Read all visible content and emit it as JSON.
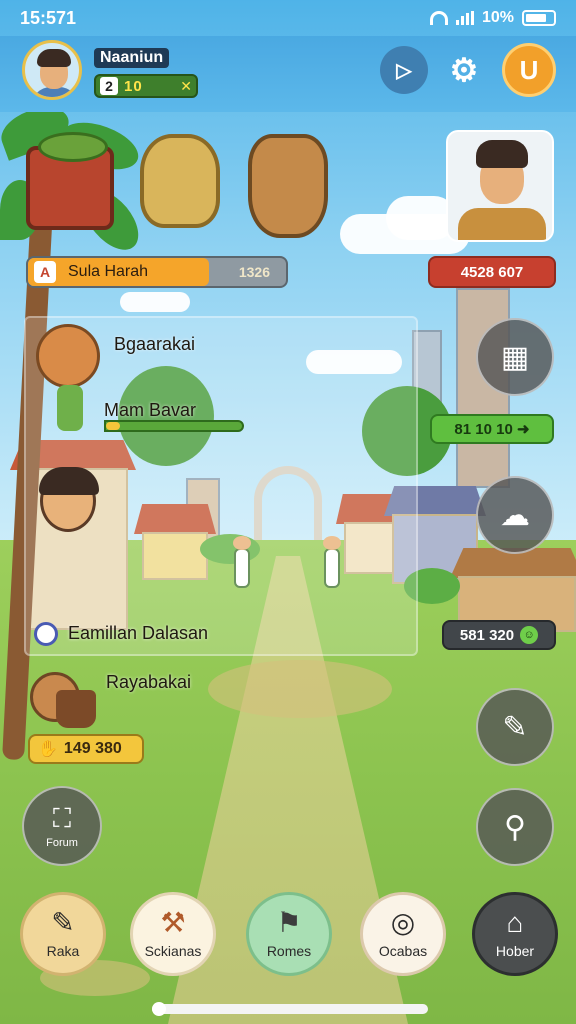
{
  "status_bar": {
    "time": "15:571",
    "battery": "10%"
  },
  "player": {
    "name": "Naaniun",
    "level": "2",
    "level_value": "10",
    "level_icon": "✕"
  },
  "header_buttons": {
    "play_icon": "play-icon",
    "gear_icon": "gear-icon",
    "user_label": "U"
  },
  "farm_bar": {
    "label": "Sula Harah",
    "value": "1326",
    "progress": 0.7
  },
  "red_badge": {
    "value": "4528 607"
  },
  "labels": {
    "bgarakai": "Bgaarakai",
    "mam": "Mam Bavar",
    "eamillan": "Eamillan Dalasan",
    "raya": "Rayabakai"
  },
  "mam_progress": 0.1,
  "gold": {
    "value": "149 380",
    "icon": "bag-icon"
  },
  "green_pill": {
    "value": "81 10 10"
  },
  "dark_pill": {
    "value": "581 320"
  },
  "side_buttons": {
    "bottom_left_caption": "Forum"
  },
  "nav": [
    {
      "label": "Raka",
      "icon": "edit-icon"
    },
    {
      "label": "Sckianas",
      "icon": "tools-icon"
    },
    {
      "label": "Romes",
      "icon": "flag-icon"
    },
    {
      "label": "Ocabas",
      "icon": "target-icon"
    },
    {
      "label": "Hober",
      "icon": "home-icon"
    }
  ],
  "colors": {
    "accent": "#f2a02a",
    "header": "#4aa9e2",
    "grass": "#8cc34f"
  }
}
